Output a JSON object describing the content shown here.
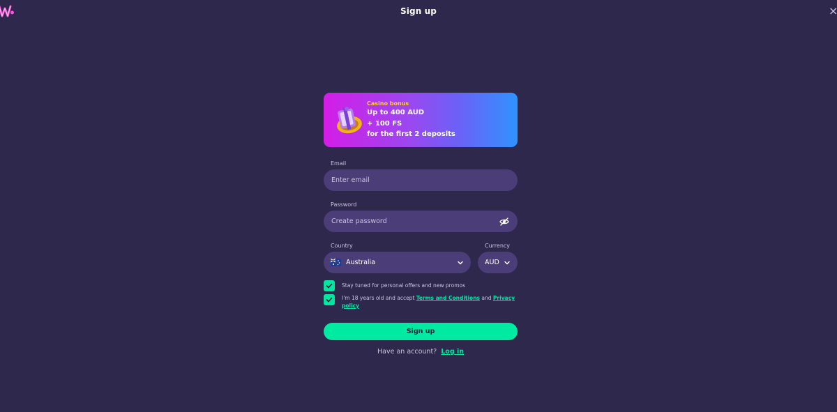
{
  "header": {
    "title": "Sign up",
    "close_glyph": "×"
  },
  "bonus": {
    "kicker": "Casino bonus",
    "line1": "Up to 400 AUD",
    "line2": "+ 100 FS",
    "line3": "for the first 2 deposits",
    "icon": "gift-box-icon"
  },
  "email": {
    "label": "Email",
    "placeholder": "Enter email",
    "value": ""
  },
  "password": {
    "label": "Password",
    "placeholder": "Create password",
    "value": "",
    "toggle_icon": "eye-off-icon"
  },
  "country": {
    "label": "Country",
    "selected": "Australia",
    "flag_icon": "australia-flag-icon"
  },
  "currency": {
    "label": "Currency",
    "selected": "AUD"
  },
  "consent": {
    "promos": {
      "checked": true,
      "text": "Stay tuned for personal offers and new promos"
    },
    "terms": {
      "checked": true,
      "text_prefix": "I'm 18 years old and accept ",
      "terms_link": "Terms and Conditions",
      "and": " and ",
      "privacy_link": "Privacy policy"
    }
  },
  "submit": {
    "label": "Sign up"
  },
  "footer": {
    "question": "Have an account?",
    "login_link": "Log in"
  },
  "colors": {
    "background": "#2e284d",
    "input_bg": "#4b3d78",
    "accent": "#00e5a0",
    "bonus_yellow": "#ffd21f"
  }
}
